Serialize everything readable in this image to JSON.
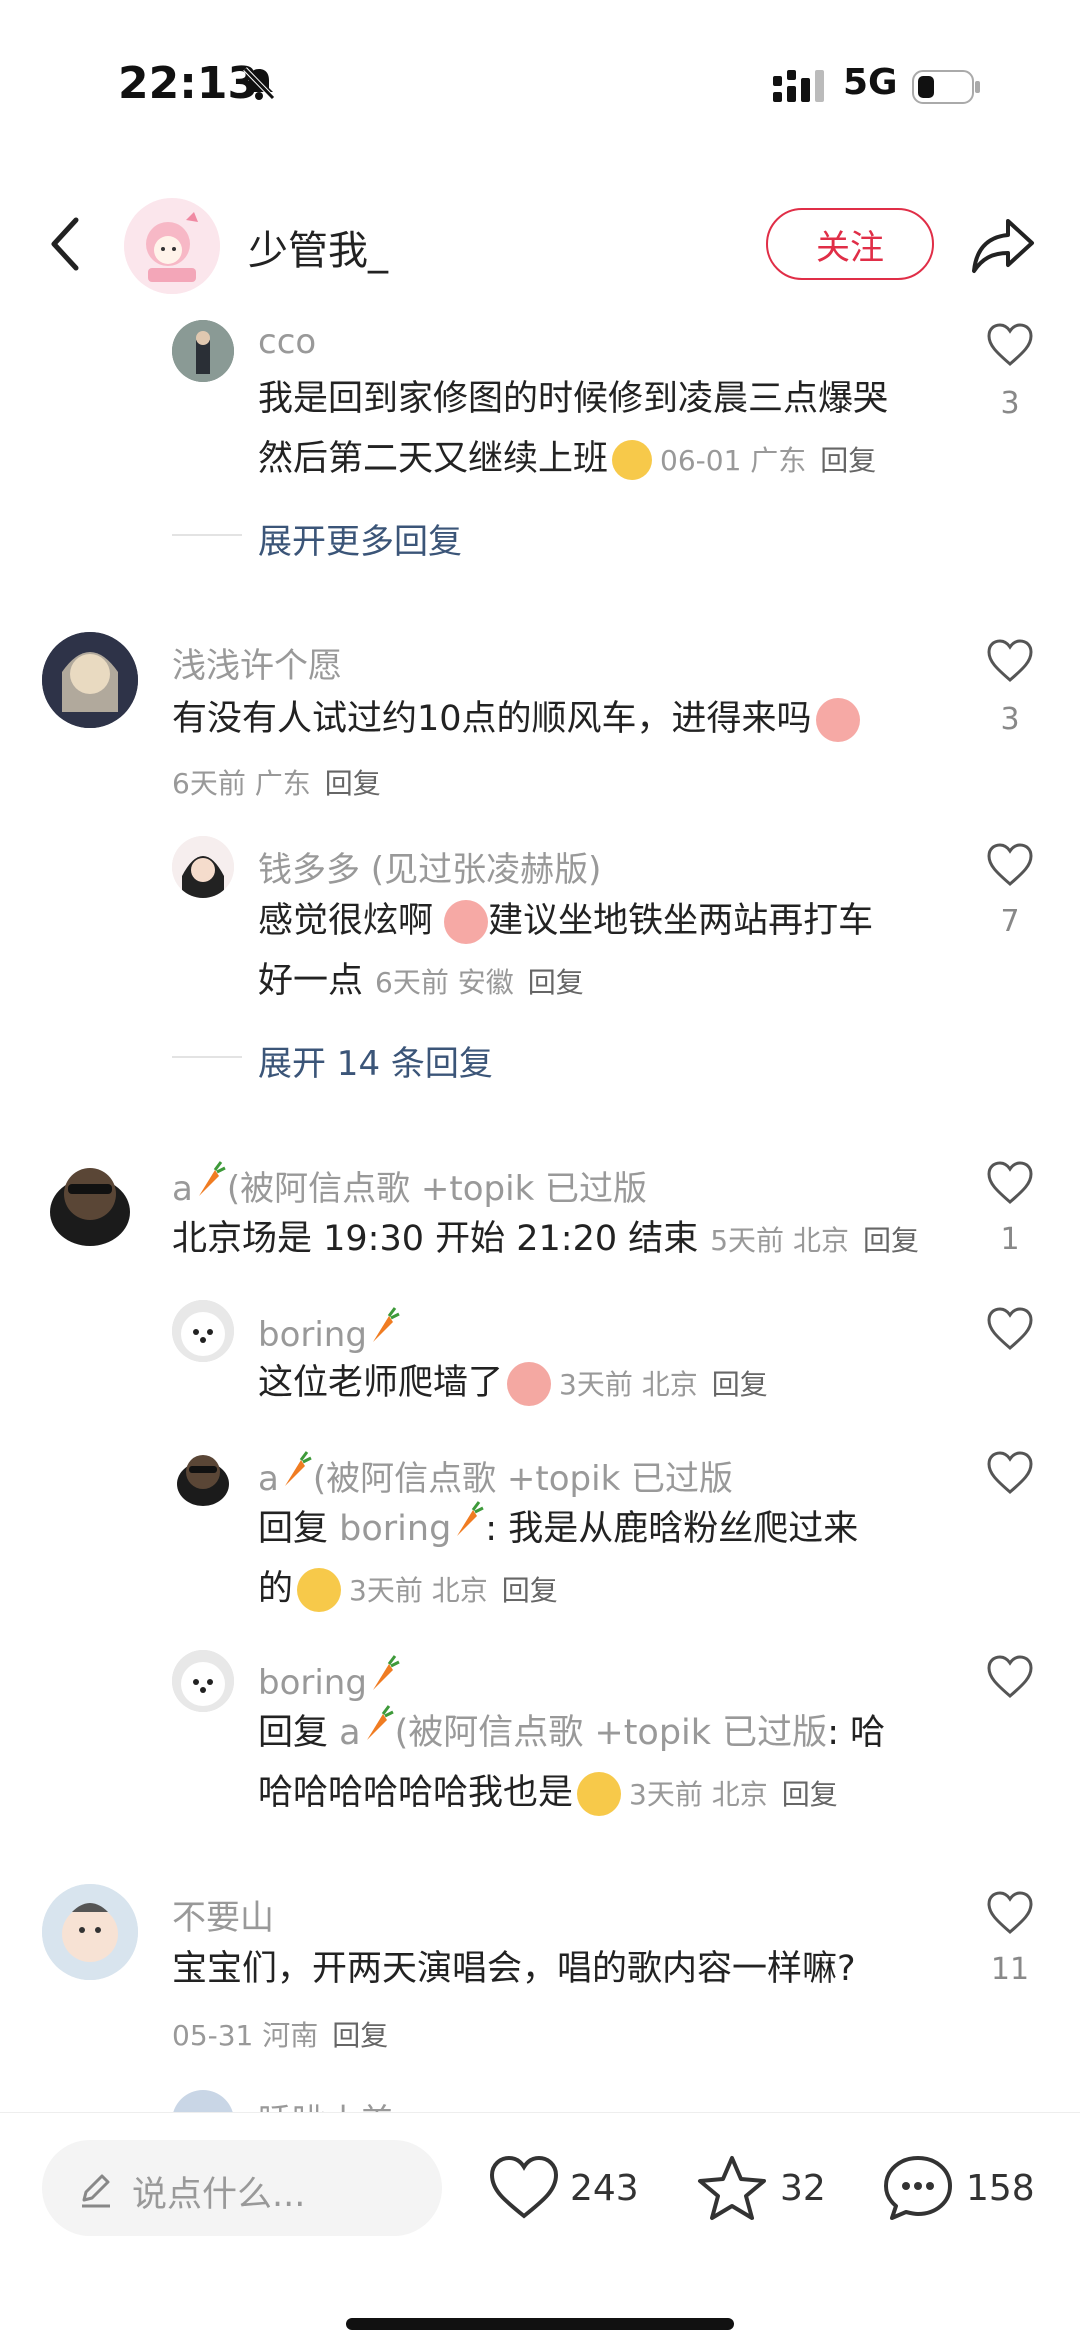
{
  "status_bar": {
    "time": "22:13",
    "network": "5G"
  },
  "header": {
    "author": "少管我_",
    "follow_label": "关注"
  },
  "comments": [
    {
      "name": "cco",
      "lines": [
        "我是回到家修图的时候修到凌晨三点爆哭",
        "然后第二天又继续上班"
      ],
      "meta": "06-01 广东",
      "reply": "回复",
      "likes": "3"
    },
    {
      "expand": "展开更多回复"
    },
    {
      "name": "浅浅许个愿",
      "lines": [
        "有没有人试过约10点的顺风车，进得来吗"
      ],
      "meta": "6天前 广东",
      "reply": "回复",
      "likes": "3"
    },
    {
      "name": "钱多多 (见过张凌赫版)",
      "lines": [
        "感觉很炫啊 ",
        "建议坐地铁坐两站再打车",
        "好一点"
      ],
      "meta": "6天前 安徽",
      "reply": "回复",
      "likes": "7"
    },
    {
      "expand": "展开 14 条回复"
    },
    {
      "name": "a",
      "name_suffix": "(被阿信点歌 +topik 已过版",
      "lines": [
        "北京场是 19:30 开始 21:20 结束"
      ],
      "meta": "5天前 北京",
      "reply": "回复",
      "likes": "1"
    },
    {
      "name": "boring",
      "lines": [
        "这位老师爬墙了"
      ],
      "meta": "3天前 北京",
      "reply": "回复",
      "likes": ""
    },
    {
      "name": "a",
      "name_suffix": "(被阿信点歌 +topik 已过版",
      "reply_prefix": "回复 ",
      "reply_to": "boring",
      "lines": [
        ": 我是从鹿晗粉丝爬过来",
        "的"
      ],
      "meta": "3天前 北京",
      "reply": "回复",
      "likes": ""
    },
    {
      "name": "boring",
      "reply_prefix": "回复 ",
      "reply_to": "a",
      "reply_to_suffix": "(被阿信点歌 +topik 已过版",
      "lines": [
        ": 哈",
        "哈哈哈哈哈哈我也是"
      ],
      "meta": "3天前 北京",
      "reply": "回复",
      "likes": ""
    },
    {
      "name": "不要山",
      "lines": [
        "宝宝们，开两天演唱会，唱的歌内容一样嘛?"
      ],
      "meta": "05-31 河南",
      "reply": "回复",
      "likes": "11"
    },
    {
      "name": "睡眦小美",
      "partial": true
    }
  ],
  "bottom_bar": {
    "input_placeholder": "说点什么...",
    "likes": "243",
    "stars": "32",
    "comments": "158"
  },
  "colors": {
    "accent": "#e02e47",
    "link": "#3b5578"
  }
}
